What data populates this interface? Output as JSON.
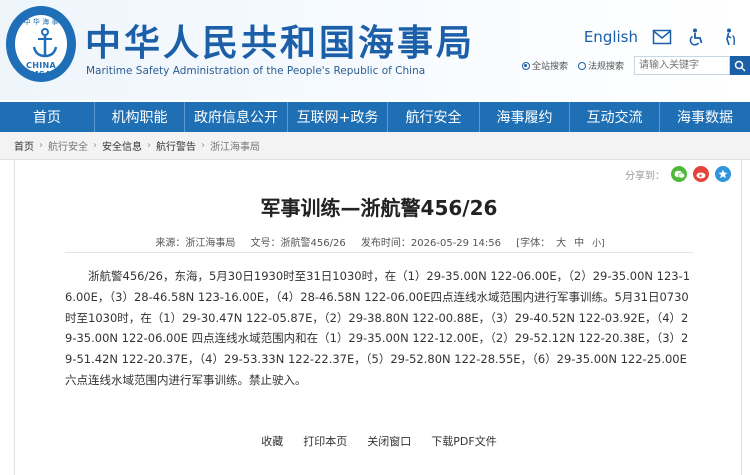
{
  "header": {
    "logo_top": "中 华 海 事",
    "logo_text": "CHINA MSA",
    "title": "中华人民共和国海事局",
    "subtitle": "Maritime Safety Administration of the People's Republic of China",
    "english_link": "English",
    "icons": [
      "mail-icon",
      "accessibility-icon",
      "elder-care-icon"
    ]
  },
  "search": {
    "option_site": "全站搜索",
    "option_law": "法规搜索",
    "placeholder": "请输入关键字",
    "selected": "全站搜索"
  },
  "nav": {
    "items": [
      "首页",
      "机构职能",
      "政府信息公开",
      "互联网+政务",
      "航行安全",
      "海事履约",
      "互动交流",
      "海事数据"
    ]
  },
  "breadcrumb": [
    "首页",
    "航行安全",
    "安全信息",
    "航行警告",
    "浙江海事局"
  ],
  "article": {
    "share_label": "分享到：",
    "title": "军事训练—浙航警456/26",
    "source": "来源：浙江海事局",
    "doc_no": "文号：浙航警456/26",
    "publish_time": "发布时间：2026-05-29 14:56",
    "font_label": "[字体：",
    "font_large": "大",
    "font_medium": "中",
    "font_small": "小]",
    "body": "浙航警456/26，东海，5月30日1930时至31日1030时，在（1）29-35.00N 122-06.00E，（2）29-35.00N 123-16.00E，（3）28-46.58N 123-16.00E，（4）28-46.58N 122-06.00E四点连线水域范围内进行军事训练。5月31日0730时至1030时，在（1）29-30.47N 122-05.87E，（2）29-38.80N 122-00.88E，（3）29-40.52N 122-03.92E，（4）29-35.00N 122-06.00E 四点连线水域范围内和在（1）29-35.00N 122-12.00E，（2）29-52.12N 122-20.38E，（3）29-51.42N 122-20.37E，（4）29-53.33N 122-22.37E，（5）29-52.80N 122-28.55E，（6）29-35.00N 122-25.00E六点连线水域范围内进行军事训练。禁止驶入。"
  },
  "actions": {
    "favorite": "收藏",
    "print": "打印本页",
    "close": "关闭窗口",
    "download_pdf": "下载PDF文件"
  },
  "colors": {
    "brand_blue": "#1f6fb5",
    "title_blue": "#1b5fa8"
  }
}
